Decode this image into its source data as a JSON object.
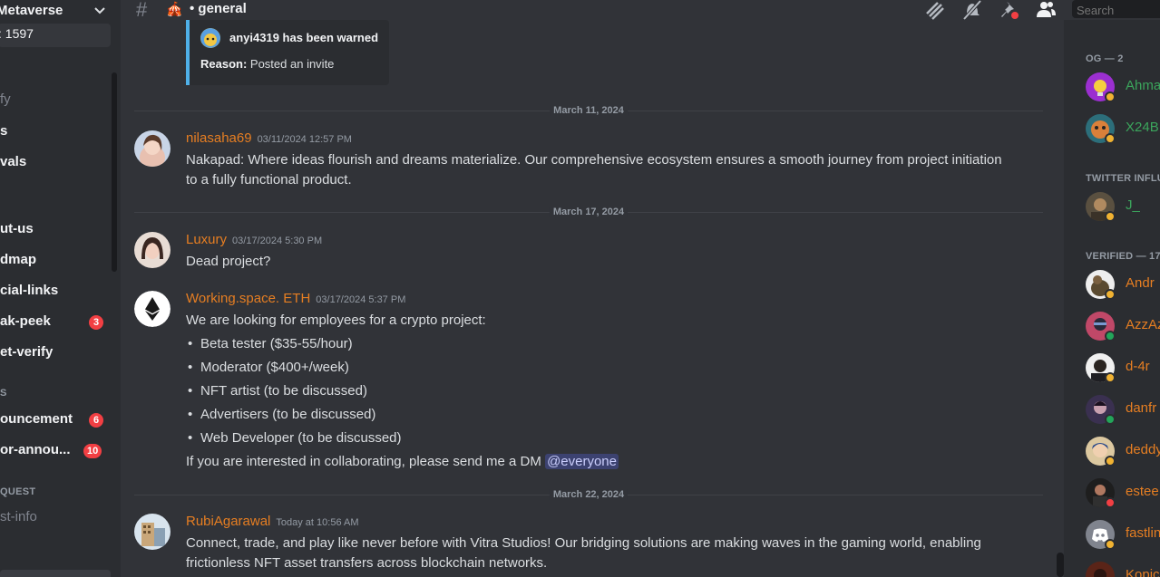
{
  "sidebar": {
    "server_name": "Metaverse",
    "member_count_label": ": 1597",
    "channels": [
      {
        "label": "fy",
        "style": "dim"
      },
      {
        "label": "s",
        "style": "bright"
      },
      {
        "label": "vals",
        "style": "bright"
      },
      {
        "label": "ut-us",
        "style": "bright"
      },
      {
        "label": "dmap",
        "style": "bright"
      },
      {
        "label": "cial-links",
        "style": "bright"
      },
      {
        "label": "ak-peek",
        "style": "bright",
        "badge": "3"
      },
      {
        "label": "et-verify",
        "style": "bright"
      },
      {
        "label": "ouncement",
        "style": "bright",
        "badge": "6"
      },
      {
        "label": "or-annou...",
        "style": "bright",
        "badge": "10"
      },
      {
        "label": "st-info",
        "style": "dim"
      }
    ],
    "category_1": "S",
    "category_2": "QUEST"
  },
  "header": {
    "channel_emoji": "🎪",
    "channel_name": "• general",
    "search_placeholder": "Search"
  },
  "icons": {
    "threads": "threads-icon",
    "mute": "bell-muted-icon",
    "pin": "pin-icon",
    "members": "members-icon"
  },
  "embed": {
    "warned_text": "anyi4319 has been warned",
    "reason_label": "Reason:",
    "reason_text": " Posted an invite"
  },
  "dividers": [
    "March 11, 2024",
    "March 17, 2024",
    "March 22, 2024"
  ],
  "messages": [
    {
      "username": "nilasaha69",
      "timestamp": "03/11/2024 12:57 PM",
      "text": "Nakapad: Where ideas flourish and dreams materialize. Our comprehensive ecosystem ensures a smooth journey from project initiation to a fully functional product."
    },
    {
      "username": "Luxury",
      "timestamp": "03/17/2024 5:30 PM",
      "text": "Dead project?"
    },
    {
      "username": "Working.space. ETH",
      "timestamp": "03/17/2024 5:37 PM",
      "intro": "We are looking for employees for a crypto project:",
      "bullets": [
        "Beta tester ($35-55/hour)",
        "Moderator ($400+/week)",
        "NFT artist (to be discussed)",
        "Advertisers (to be discussed)",
        "Web Developer (to be discussed)"
      ],
      "outro": "If you are interested in collaborating, please send me a DM ",
      "mention": "@everyone"
    },
    {
      "username": "RubiAgarawal",
      "timestamp": "Today at 10:56 AM",
      "text": "Connect, trade, and play like never before with Vitra Studios! Our bridging solutions are making waves in the gaming world, enabling frictionless NFT asset transfers across blockchain networks."
    }
  ],
  "member_list": {
    "categories": [
      "OG — 2",
      "TWITTER INFLU",
      "VERIFIED — 17"
    ],
    "members": [
      {
        "name": "Ahma",
        "color": "#3ba55c",
        "status": "idle"
      },
      {
        "name": "X24B",
        "color": "#3ba55c",
        "status": "idle"
      },
      {
        "name": "J_",
        "color": "#3ba55c",
        "status": "idle"
      },
      {
        "name": "Andr",
        "color": "#e67e22",
        "status": "idle"
      },
      {
        "name": "AzzAz",
        "color": "#e67e22",
        "status": "online"
      },
      {
        "name": "d-4r",
        "color": "#e67e22",
        "status": "idle"
      },
      {
        "name": "danfr",
        "color": "#e67e22",
        "status": "online"
      },
      {
        "name": "deddy",
        "color": "#e67e22",
        "status": "idle"
      },
      {
        "name": "estee",
        "color": "#e67e22",
        "status": "dnd"
      },
      {
        "name": "fastlin",
        "color": "#e67e22",
        "status": "idle"
      },
      {
        "name": "Kopic",
        "color": "#e67e22",
        "status": "idle"
      }
    ]
  },
  "colors": {
    "username": "#e67e22",
    "background": "#313338",
    "sidebar": "#2b2d31",
    "mention_bg": "#3c4270",
    "badge": "#f23f43",
    "online": "#23a55a",
    "idle": "#f0b232",
    "dnd": "#f23f43"
  }
}
